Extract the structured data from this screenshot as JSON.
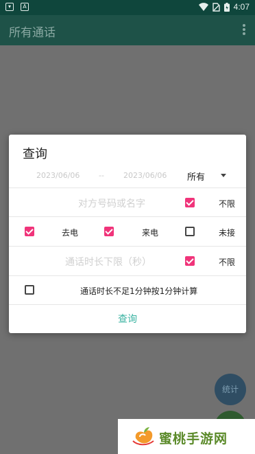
{
  "status_bar": {
    "time": "4:07",
    "left_icons": [
      "shield-icon",
      "a-icon"
    ],
    "right_icons": [
      "wifi-icon",
      "no-sim-icon",
      "battery-icon"
    ]
  },
  "app_bar": {
    "title": "所有通话",
    "more_icon": "more-vertical-icon"
  },
  "dialog": {
    "title": "查询",
    "date_start": "2023/06/06",
    "date_separator": "--",
    "date_end": "2023/06/06",
    "type_select": "所有",
    "number_placeholder": "对方号码或名字",
    "unlimited_label_1": "不限",
    "outgoing_label": "去电",
    "incoming_label": "来电",
    "missed_label": "未接",
    "duration_placeholder": "通话时长下限（秒）",
    "unlimited_label_2": "不限",
    "round_minute_label": "通话时长不足1分钟按1分钟计算",
    "query_button": "查询",
    "checkboxes": {
      "number_unlimited": true,
      "outgoing": true,
      "incoming": true,
      "missed": false,
      "duration_unlimited": true,
      "round_minute": false
    }
  },
  "fab": {
    "stats_label": "统计"
  },
  "watermark": {
    "text": "蜜桃手游网"
  },
  "colors": {
    "accent": "#f0347a",
    "primary_dark": "#0f463c",
    "link": "#3bb3a2"
  }
}
